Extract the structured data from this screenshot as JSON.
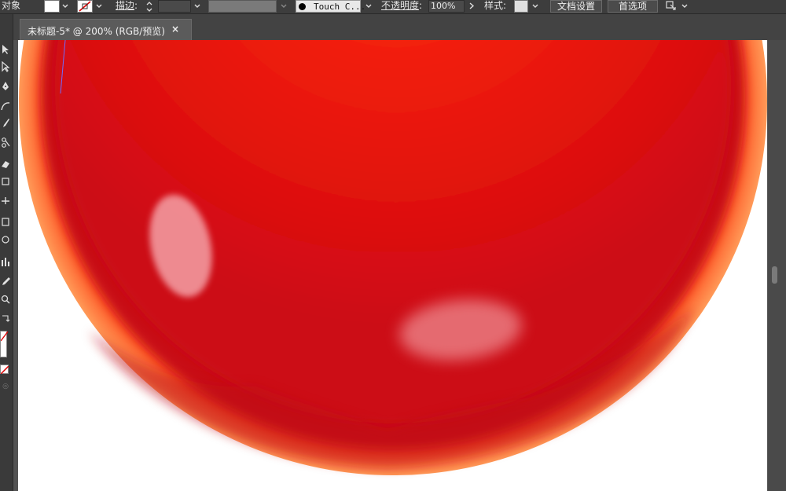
{
  "control_bar": {
    "object_label": "对象",
    "stroke_label": "描边",
    "brush_name": "Touch C...",
    "opacity_label": "不透明度",
    "opacity_value": "100%",
    "style_label": "样式",
    "doc_setup_button": "文档设置",
    "preferences_button": "首选项"
  },
  "document_tab": {
    "title": "未标题-5* @ 200% (RGB/预览)",
    "close_glyph": "×"
  },
  "colors": {
    "ui_dark": "#3d3d3d",
    "canvas_bg": "#535353",
    "sphere_core": "#ff3a0a",
    "sphere_mid": "#d8100f",
    "sphere_rim": "#ff8a4a"
  },
  "icons": [
    "fill-swatch-icon",
    "stroke-swatch-icon",
    "brush-dot-icon",
    "arrange-icon",
    "selection-tool-icon",
    "direct-selection-tool-icon",
    "pen-tool-icon",
    "curvature-tool-icon",
    "paintbrush-tool-icon",
    "shaper-tool-icon",
    "eraser-tool-icon",
    "rotate-tool-icon",
    "width-tool-icon",
    "free-transform-tool-icon",
    "shape-builder-tool-icon",
    "perspective-grid-tool-icon",
    "mesh-tool-icon",
    "gradient-tool-icon",
    "blend-tool-icon",
    "symbol-sprayer-tool-icon",
    "column-graph-tool-icon",
    "eyedropper-tool-icon",
    "zoom-tool-icon",
    "swap-colors-icon",
    "none-color-icon"
  ]
}
